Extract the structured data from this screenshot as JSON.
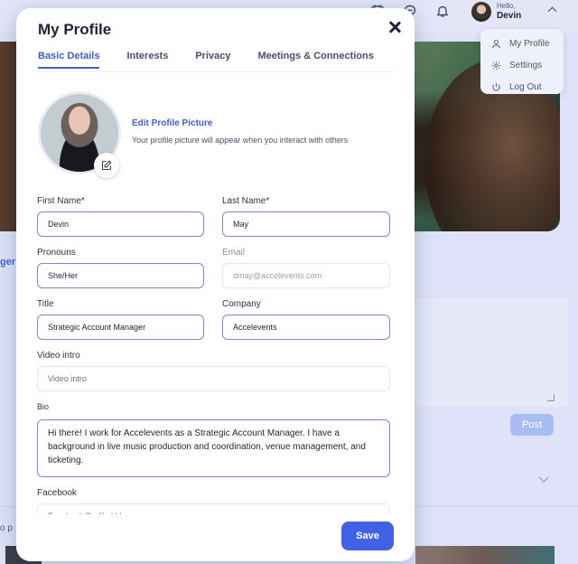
{
  "topbar": {
    "greeting": "Hello,",
    "user_name": "Devin",
    "icons": [
      "calendar-icon",
      "messages-icon",
      "bell-icon"
    ]
  },
  "user_menu": {
    "items": [
      {
        "label": "My Profile",
        "icon": "user-icon"
      },
      {
        "label": "Settings",
        "icon": "gear-icon"
      },
      {
        "label": "Log Out",
        "icon": "power-icon"
      }
    ]
  },
  "background": {
    "tag_fragment": "ger",
    "post_label": "Post",
    "text_fragment": "o p"
  },
  "modal": {
    "title": "My Profile",
    "tabs": [
      {
        "label": "Basic Details",
        "active": true
      },
      {
        "label": "Interests",
        "active": false
      },
      {
        "label": "Privacy",
        "active": false
      },
      {
        "label": "Meetings & Connections",
        "active": false
      }
    ],
    "picture": {
      "edit_label": "Edit Profile Picture",
      "help_text": "Your profile picture will appear when you interact with others"
    },
    "fields": {
      "first_name": {
        "label": "First Name*",
        "value": "Devin"
      },
      "last_name": {
        "label": "Last Name*",
        "value": "May"
      },
      "pronouns": {
        "label": "Pronouns",
        "value": "She/Her"
      },
      "email": {
        "label": "Email",
        "value": "dmay@accelevents.com"
      },
      "title": {
        "label": "Title",
        "value": "Strategic Account Manager"
      },
      "company": {
        "label": "Company",
        "value": "Accelevents"
      },
      "video_intro": {
        "label": "Video intro",
        "placeholder": "Video intro"
      },
      "bio": {
        "label": "Bio",
        "value": "Hi there! I work for Accelevents as a Strategic Account Manager. I have a background in live music production and coordination, venue management, and ticketing."
      },
      "facebook": {
        "label": "Facebook",
        "placeholder": "Facebook Profile Url"
      }
    },
    "save_label": "Save"
  },
  "colors": {
    "accent": "#3e62bd",
    "save_button": "#4262e6",
    "field_border": "#7a8ac9"
  }
}
